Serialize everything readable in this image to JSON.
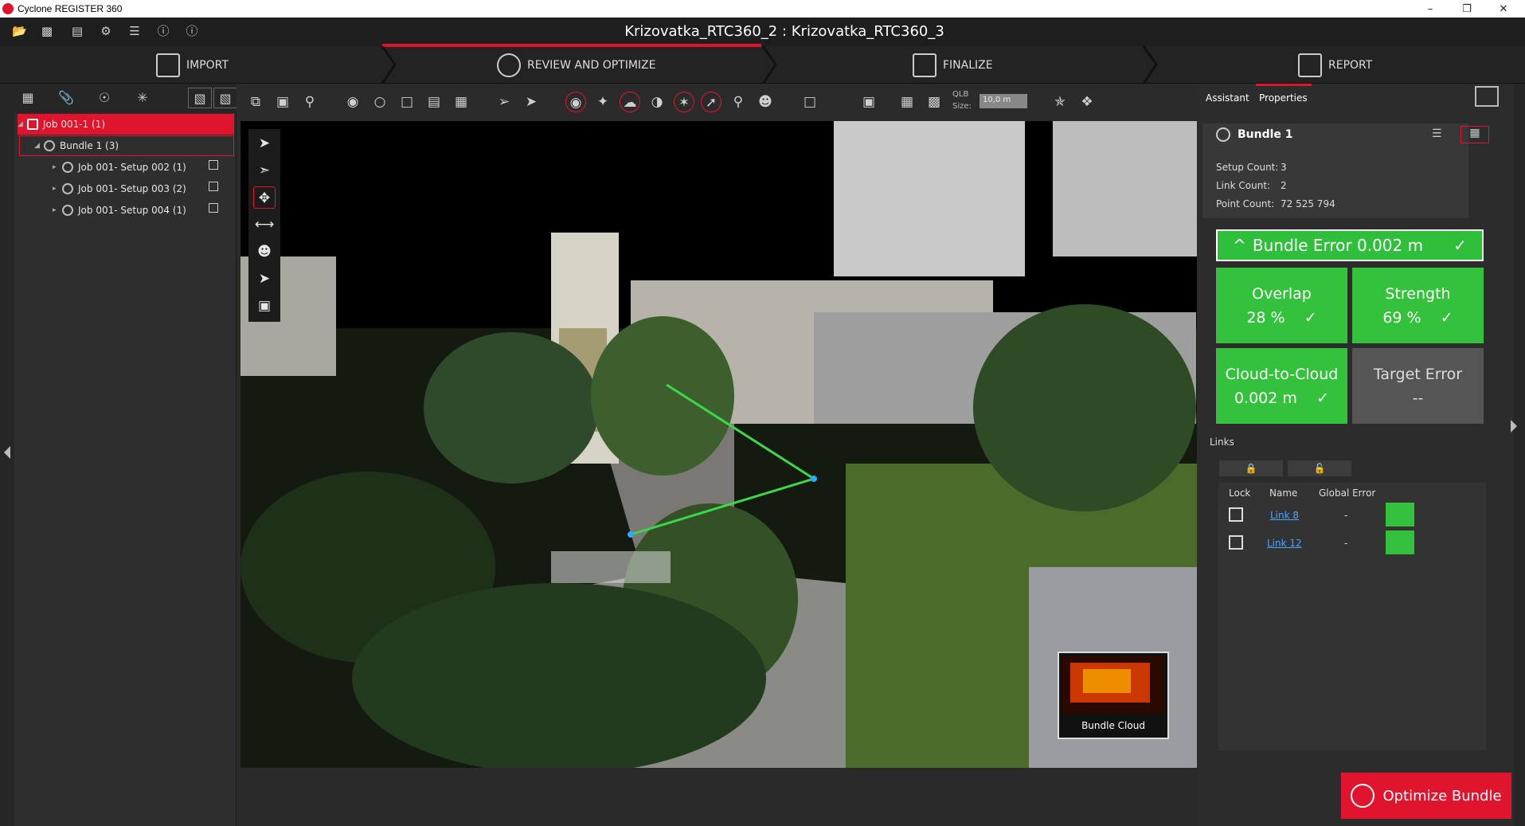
{
  "window": {
    "title": "Cyclone REGISTER 360",
    "minimize": "–",
    "restore": "❐",
    "close": "✕"
  },
  "document": {
    "title": "Krizovatka_RTC360_2 : Krizovatka_RTC360_3"
  },
  "workflow": {
    "steps": [
      {
        "label": "IMPORT"
      },
      {
        "label": "REVIEW AND OPTIMIZE"
      },
      {
        "label": "FINALIZE"
      },
      {
        "label": "REPORT"
      }
    ]
  },
  "tree": {
    "items": [
      {
        "label": "Job 001-1 (1)"
      },
      {
        "label": "Bundle 1 (3)"
      },
      {
        "label": "Job 001- Setup 002 (1)"
      },
      {
        "label": "Job 001- Setup 003 (2)"
      },
      {
        "label": "Job 001- Setup 004 (1)"
      }
    ]
  },
  "toolbar": {
    "qlb_label": "QLB",
    "size_label": "Size:",
    "size_value": "10,0 m"
  },
  "thumbnail": {
    "label": "Bundle Cloud"
  },
  "right_panel": {
    "tabs": [
      {
        "label": "Assistant"
      },
      {
        "label": "Properties"
      }
    ],
    "bundle": {
      "name": "Bundle 1",
      "setup_count_label": "Setup Count:",
      "setup_count": "3",
      "link_count_label": "Link Count:",
      "link_count": "2",
      "point_count_label": "Point Count:",
      "point_count": "72 525 794"
    },
    "bundle_error": {
      "arrow": "^",
      "label": "Bundle Error 0.002 m",
      "check": "✓"
    },
    "tiles": [
      {
        "title": "Overlap",
        "value": "28 %",
        "check": "✓",
        "status": "ok"
      },
      {
        "title": "Strength",
        "value": "69 %",
        "check": "✓",
        "status": "ok"
      },
      {
        "title": "Cloud-to-Cloud",
        "value": "0.002 m",
        "check": "✓",
        "status": "ok"
      },
      {
        "title": "Target Error",
        "value": "--",
        "status": "none"
      }
    ],
    "links_label": "Links",
    "links_columns": [
      "Lock",
      "Name",
      "Global Error"
    ],
    "links": [
      {
        "name": "Link 8",
        "global_error": "-",
        "locked": false
      },
      {
        "name": "Link 12",
        "global_error": "-",
        "locked": false
      }
    ],
    "optimize_label": "Optimize Bundle"
  },
  "colors": {
    "accent": "#e0142c",
    "ok": "#34c23c",
    "panel": "#2c2c2c"
  }
}
